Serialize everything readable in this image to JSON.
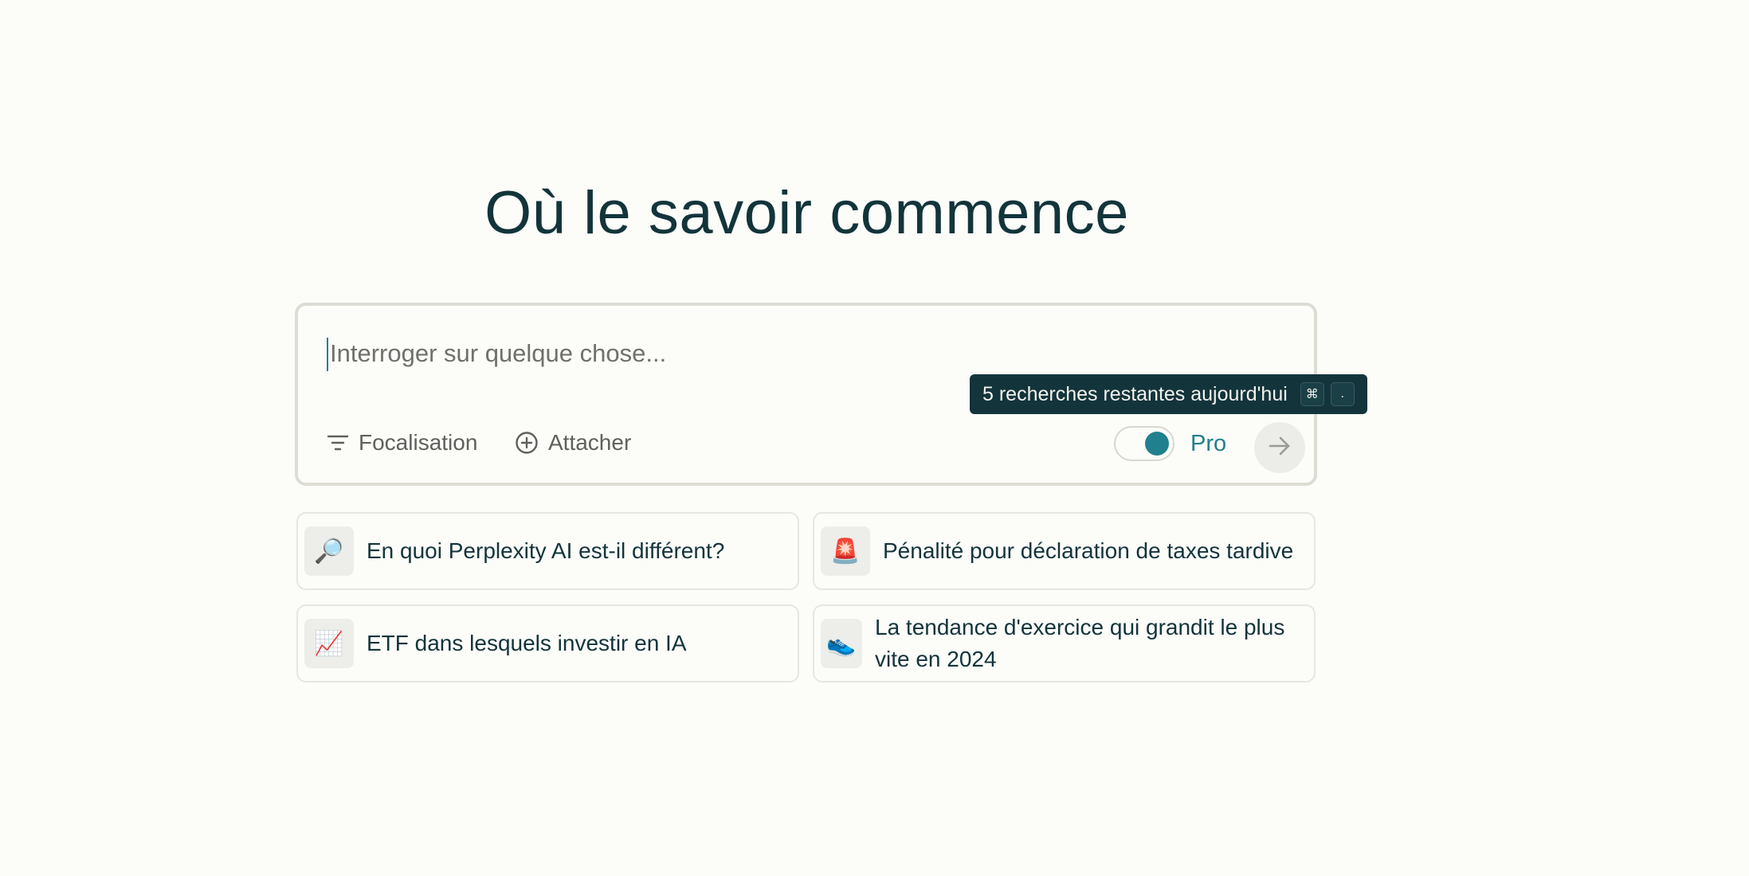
{
  "header": {
    "title": "Où le savoir commence"
  },
  "search": {
    "placeholder": "Interroger sur quelque chose...",
    "value": "",
    "focus_label": "Focalisation",
    "attach_label": "Attacher",
    "pro_label": "Pro",
    "pro_enabled": true
  },
  "tooltip": {
    "text": "5 recherches restantes aujourd'hui",
    "keys": [
      "⌘",
      "."
    ]
  },
  "suggestions": [
    {
      "icon": "magnifying-glass-icon",
      "emoji": "🔎",
      "label": "En quoi Perplexity AI est-il différent?"
    },
    {
      "icon": "siren-icon",
      "emoji": "🚨",
      "label": "Pénalité pour déclaration de taxes tardive"
    },
    {
      "icon": "chart-increasing-icon",
      "emoji": "📈",
      "label": "ETF dans lesquels investir en IA"
    },
    {
      "icon": "running-shoe-icon",
      "emoji": "👟",
      "label": "La tendance d'exercice qui grandit le plus vite en 2024"
    }
  ],
  "colors": {
    "accent": "#20808d",
    "text": "#13343b",
    "background": "#fcfcf9",
    "tooltip_bg": "#13343b"
  }
}
